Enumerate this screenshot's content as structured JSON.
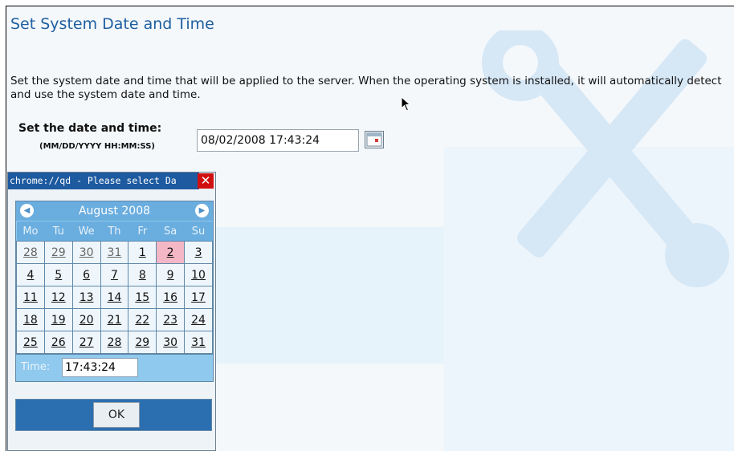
{
  "page": {
    "title": "Set System Date and Time",
    "description": "Set the system date and time that will be applied to the server. When the operating system is installed, it will automatically detect and use the system date and time.",
    "datetime_label": "Set the date and time:",
    "datetime_hint": "(MM/DD/YYYY HH:MM:SS)",
    "datetime_value": "08/02/2008 17:43:24",
    "calendar_button_icon": "calendar-icon"
  },
  "popup": {
    "window_title": "chrome://qd - Please select Da",
    "close_icon": "close-icon",
    "calendar": {
      "month_label": "August 2008",
      "prev_icon": "chevron-left-icon",
      "next_icon": "chevron-right-icon",
      "weekdays": [
        "Mo",
        "Tu",
        "We",
        "Th",
        "Fr",
        "Sa",
        "Su"
      ],
      "weeks": [
        [
          "28",
          "29",
          "30",
          "31",
          "1",
          "2",
          "3"
        ],
        [
          "4",
          "5",
          "6",
          "7",
          "8",
          "9",
          "10"
        ],
        [
          "11",
          "12",
          "13",
          "14",
          "15",
          "16",
          "17"
        ],
        [
          "18",
          "19",
          "20",
          "21",
          "22",
          "23",
          "24"
        ],
        [
          "25",
          "26",
          "27",
          "28",
          "29",
          "30",
          "31"
        ]
      ],
      "selected_day": "2",
      "time_label": "Time:",
      "time_value": "17:43:24",
      "ok_label": "OK"
    }
  },
  "colors": {
    "title": "#1f5fa0",
    "popup_titlebar": "#1d5aa0",
    "calendar_header": "#6aaddf",
    "selected_day": "#f4b7c5",
    "close_button": "#d01010"
  }
}
